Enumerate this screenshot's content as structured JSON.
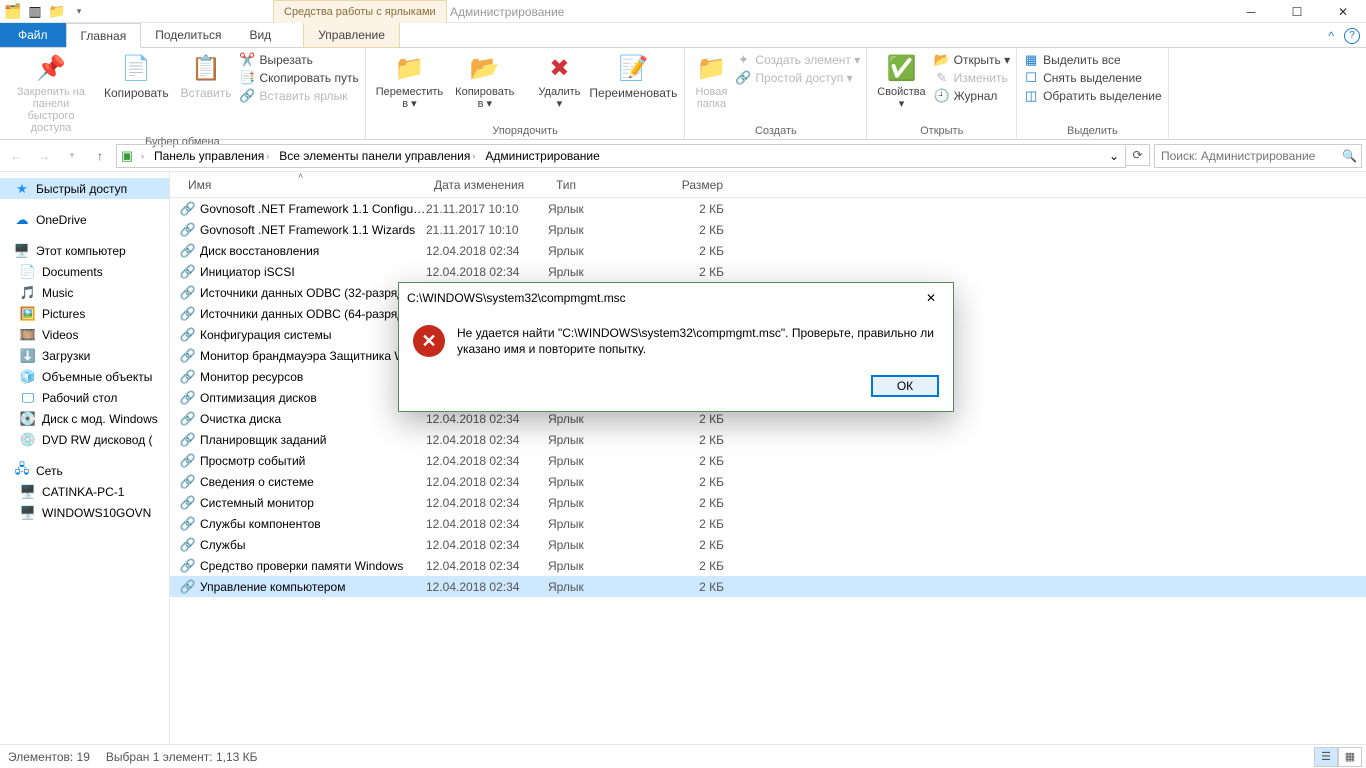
{
  "title_context": "Средства работы с ярлыками",
  "title_app": "Администрирование",
  "tabs": {
    "file": "Файл",
    "home": "Главная",
    "share": "Поделиться",
    "view": "Вид",
    "manage": "Управление"
  },
  "ribbon": {
    "pin": "Закрепить на панели\nбыстрого доступа",
    "copy": "Копировать",
    "paste": "Вставить",
    "cut": "Вырезать",
    "copypath": "Скопировать путь",
    "pastelnk": "Вставить ярлык",
    "grp_clip": "Буфер обмена",
    "moveto": "Переместить\nв ▾",
    "copyto": "Копировать\nв ▾",
    "delete": "Удалить\n▾",
    "rename": "Переименовать",
    "grp_org": "Упорядочить",
    "newfolder": "Новая\nпапка",
    "newitem": "Создать элемент ▾",
    "easyaccess": "Простой доступ ▾",
    "grp_new": "Создать",
    "props": "Свойства\n▾",
    "open": "Открыть ▾",
    "edit": "Изменить",
    "history": "Журнал",
    "grp_open": "Открыть",
    "selall": "Выделить все",
    "selnone": "Снять выделение",
    "selinv": "Обратить выделение",
    "grp_sel": "Выделить"
  },
  "breadcrumb": [
    "Панель управления",
    "Все элементы панели управления",
    "Администрирование"
  ],
  "search_placeholder": "Поиск: Администрирование",
  "nav": {
    "quick": "Быстрый доступ",
    "onedrive": "OneDrive",
    "thispc": "Этот компьютер",
    "documents": "Documents",
    "music": "Music",
    "pictures": "Pictures",
    "videos": "Videos",
    "downloads": "Загрузки",
    "objects3d": "Объемные объекты",
    "desktop": "Рабочий стол",
    "moddisk": "Диск с мод. Windows",
    "dvd": "DVD RW дисковод (",
    "network": "Сеть",
    "pc1": "CATINKA-PC-1",
    "pc2": "WINDOWS10GOVN"
  },
  "columns": {
    "name": "Имя",
    "date": "Дата изменения",
    "type": "Тип",
    "size": "Размер"
  },
  "type_label": "Ярлык",
  "size_label": "2 КБ",
  "rows": [
    {
      "n": "Govnosoft .NET Framework 1.1 Configur...",
      "d": "21.11.2017 10:10"
    },
    {
      "n": "Govnosoft .NET Framework 1.1 Wizards",
      "d": "21.11.2017 10:10"
    },
    {
      "n": "Диск восстановления",
      "d": "12.04.2018 02:34"
    },
    {
      "n": "Инициатор iSCSI",
      "d": "12.04.2018 02:34"
    },
    {
      "n": "Источники данных ODBC (32-разрядная версия)",
      "d": ""
    },
    {
      "n": "Источники данных ODBC (64-разрядная версия)",
      "d": ""
    },
    {
      "n": "Конфигурация системы",
      "d": ""
    },
    {
      "n": "Монитор брандмауэра Защитника Windows",
      "d": ""
    },
    {
      "n": "Монитор ресурсов",
      "d": ""
    },
    {
      "n": "Оптимизация дисков",
      "d": ""
    },
    {
      "n": "Очистка диска",
      "d": "12.04.2018 02:34"
    },
    {
      "n": "Планировщик заданий",
      "d": "12.04.2018 02:34"
    },
    {
      "n": "Просмотр событий",
      "d": "12.04.2018 02:34"
    },
    {
      "n": "Сведения о системе",
      "d": "12.04.2018 02:34"
    },
    {
      "n": "Системный монитор",
      "d": "12.04.2018 02:34"
    },
    {
      "n": "Службы компонентов",
      "d": "12.04.2018 02:34"
    },
    {
      "n": "Службы",
      "d": "12.04.2018 02:34"
    },
    {
      "n": "Средство проверки памяти Windows",
      "d": "12.04.2018 02:34"
    },
    {
      "n": "Управление компьютером",
      "d": "12.04.2018 02:34",
      "sel": true
    }
  ],
  "status": {
    "count": "Элементов: 19",
    "sel": "Выбран 1 элемент: 1,13 КБ"
  },
  "dialog": {
    "title": "C:\\WINDOWS\\system32\\compmgmt.msc",
    "text": "Не удается найти \"C:\\WINDOWS\\system32\\compmgmt.msc\". Проверьте, правильно ли указано имя и повторите попытку.",
    "ok": "ОК"
  }
}
